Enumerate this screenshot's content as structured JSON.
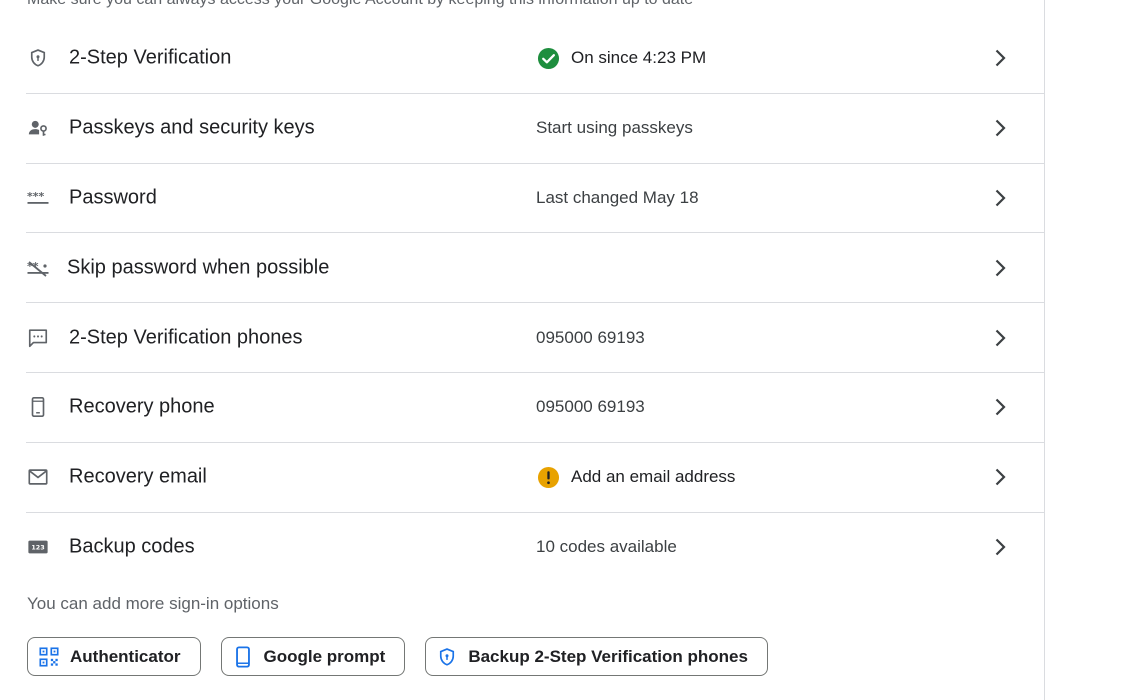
{
  "intro_text": "Make sure you can always access your Google Account by keeping this information up to date",
  "colors": {
    "success": "#1e8e3e",
    "warning": "#e37400",
    "accent_blue": "#1a73e8",
    "icon_gray": "#5f6368",
    "divider": "#dadce0"
  },
  "rows": [
    {
      "title": "2-Step Verification",
      "status": "On since 4:23 PM",
      "icon": "shield-icon",
      "status_icon": "check-circle-icon"
    },
    {
      "title": "Passkeys and security keys",
      "status": "Start using passkeys",
      "icon": "passkey-icon"
    },
    {
      "title": "Password",
      "status": "Last changed May 18",
      "icon": "password-dots-icon"
    },
    {
      "title": "Skip password when possible",
      "status": "",
      "icon": "skip-password-icon"
    },
    {
      "title": "2-Step Verification phones",
      "status": "095000 69193",
      "icon": "sms-icon"
    },
    {
      "title": "Recovery phone",
      "status": "095000 69193",
      "icon": "phone-icon"
    },
    {
      "title": "Recovery email",
      "status": "Add an email address",
      "icon": "mail-icon",
      "status_icon": "warning-circle-icon"
    },
    {
      "title": "Backup codes",
      "status": "10 codes available",
      "icon": "backup-codes-icon"
    }
  ],
  "more_options_label": "You can add more sign-in options",
  "chips": [
    {
      "label": "Authenticator",
      "icon": "qr-code-icon"
    },
    {
      "label": "Google prompt",
      "icon": "smartphone-icon"
    },
    {
      "label": "Backup 2-Step Verification phones",
      "icon": "shield-icon"
    }
  ]
}
